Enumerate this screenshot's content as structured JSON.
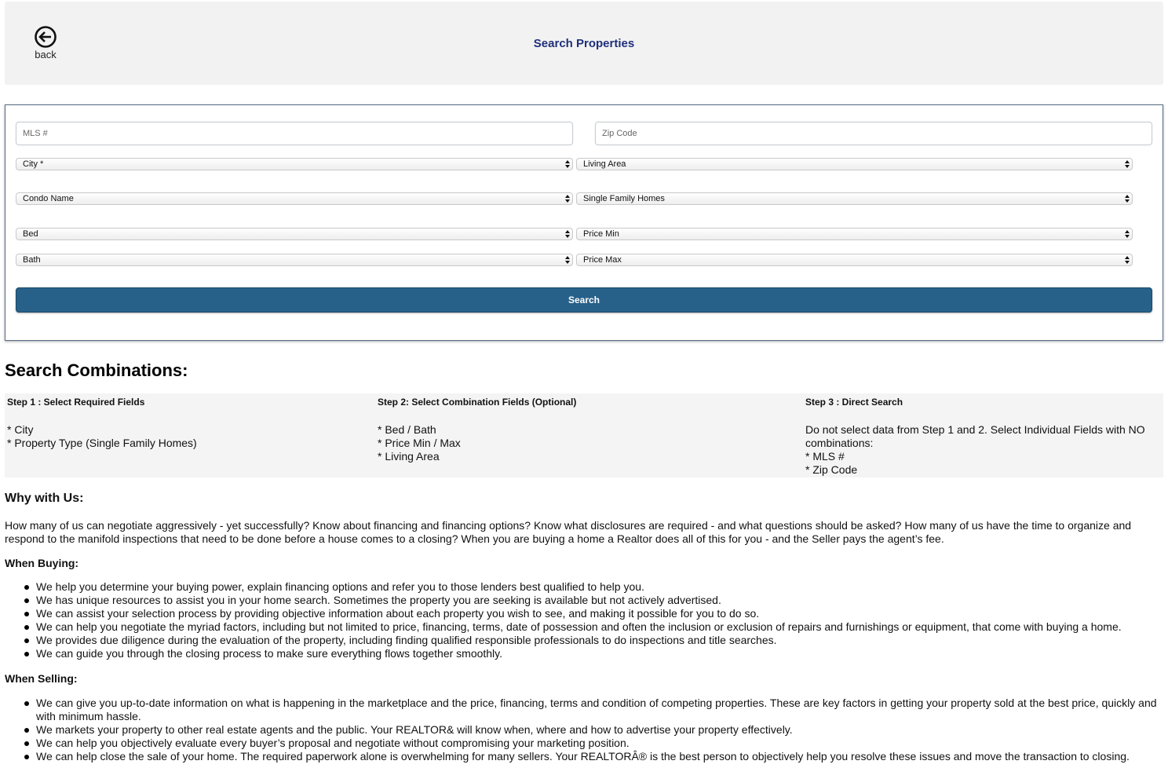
{
  "header": {
    "back_label": "back",
    "title": "Search Properties"
  },
  "search": {
    "mls_placeholder": "MLS #",
    "zip_placeholder": "Zip Code",
    "city": "City *",
    "living_area": "Living Area",
    "condo_name": "Condo Name",
    "property_type": "Single Family Homes",
    "bed": "Bed",
    "price_min": "Price Min",
    "bath": "Bath",
    "price_max": "Price Max",
    "button_label": "Search"
  },
  "combinations": {
    "heading": "Search Combinations:",
    "steps": [
      {
        "title": "Step 1 : Select Required Fields",
        "lines": [
          "* City",
          "* Property Type (Single Family Homes)"
        ]
      },
      {
        "title": "Step 2: Select Combination Fields (Optional)",
        "lines": [
          "* Bed / Bath",
          "* Price Min / Max",
          "* Living Area"
        ]
      },
      {
        "title": "Step 3 : Direct Search",
        "lines": [
          "Do not select data from Step 1 and 2. Select Individual Fields with NO",
          "combinations:",
          "* MLS #",
          "* Zip Code"
        ]
      }
    ]
  },
  "why": {
    "heading": "Why with Us:",
    "text": "How many of us can negotiate aggressively - yet successfully? Know about financing and financing options? Know what disclosures are required - and what questions should be asked? How many of us have the time to organize and respond to the manifold inspections that need to be done before a house comes to a closing? When you are buying a home a Realtor does all of this for you - and the Seller pays the agent’s fee.",
    "buying_heading": "When Buying:",
    "buying": [
      "We help you determine your buying power, explain financing options and refer you to those lenders best qualified to help you.",
      "We has unique resources to assist you in your home search. Sometimes the property you are seeking is available but not actively advertised.",
      "We can assist your selection process by providing objective information about each property you wish to see, and making it possible for you to do so.",
      "We can help you negotiate the myriad factors, including but not limited to price, financing, terms, date of possession and often the inclusion or exclusion of repairs and furnishings or equipment, that come with buying a home.",
      "We provides due diligence during the evaluation of the property, including finding qualified responsible professionals to do inspections and title searches.",
      "We can guide you through the closing process to make sure everything flows together smoothly."
    ],
    "selling_heading": "When Selling:",
    "selling": [
      "We can give you up-to-date information on what is happening in the marketplace and the price, financing, terms and condition of competing properties. These are key factors in getting your property sold at the best price, quickly and with minimum hassle.",
      "We markets your property to other real estate agents and the public. Your REALTOR& will know when, where and how to advertise your property effectively.",
      "We can help you objectively evaluate every buyer’s proposal and negotiate without compromising your marketing position.",
      "We can help close the sale of your home. The required paperwork alone is overwhelming for many sellers. Your REALTORÂ® is the best person to objectively help you resolve these issues and move the transaction to closing."
    ]
  }
}
